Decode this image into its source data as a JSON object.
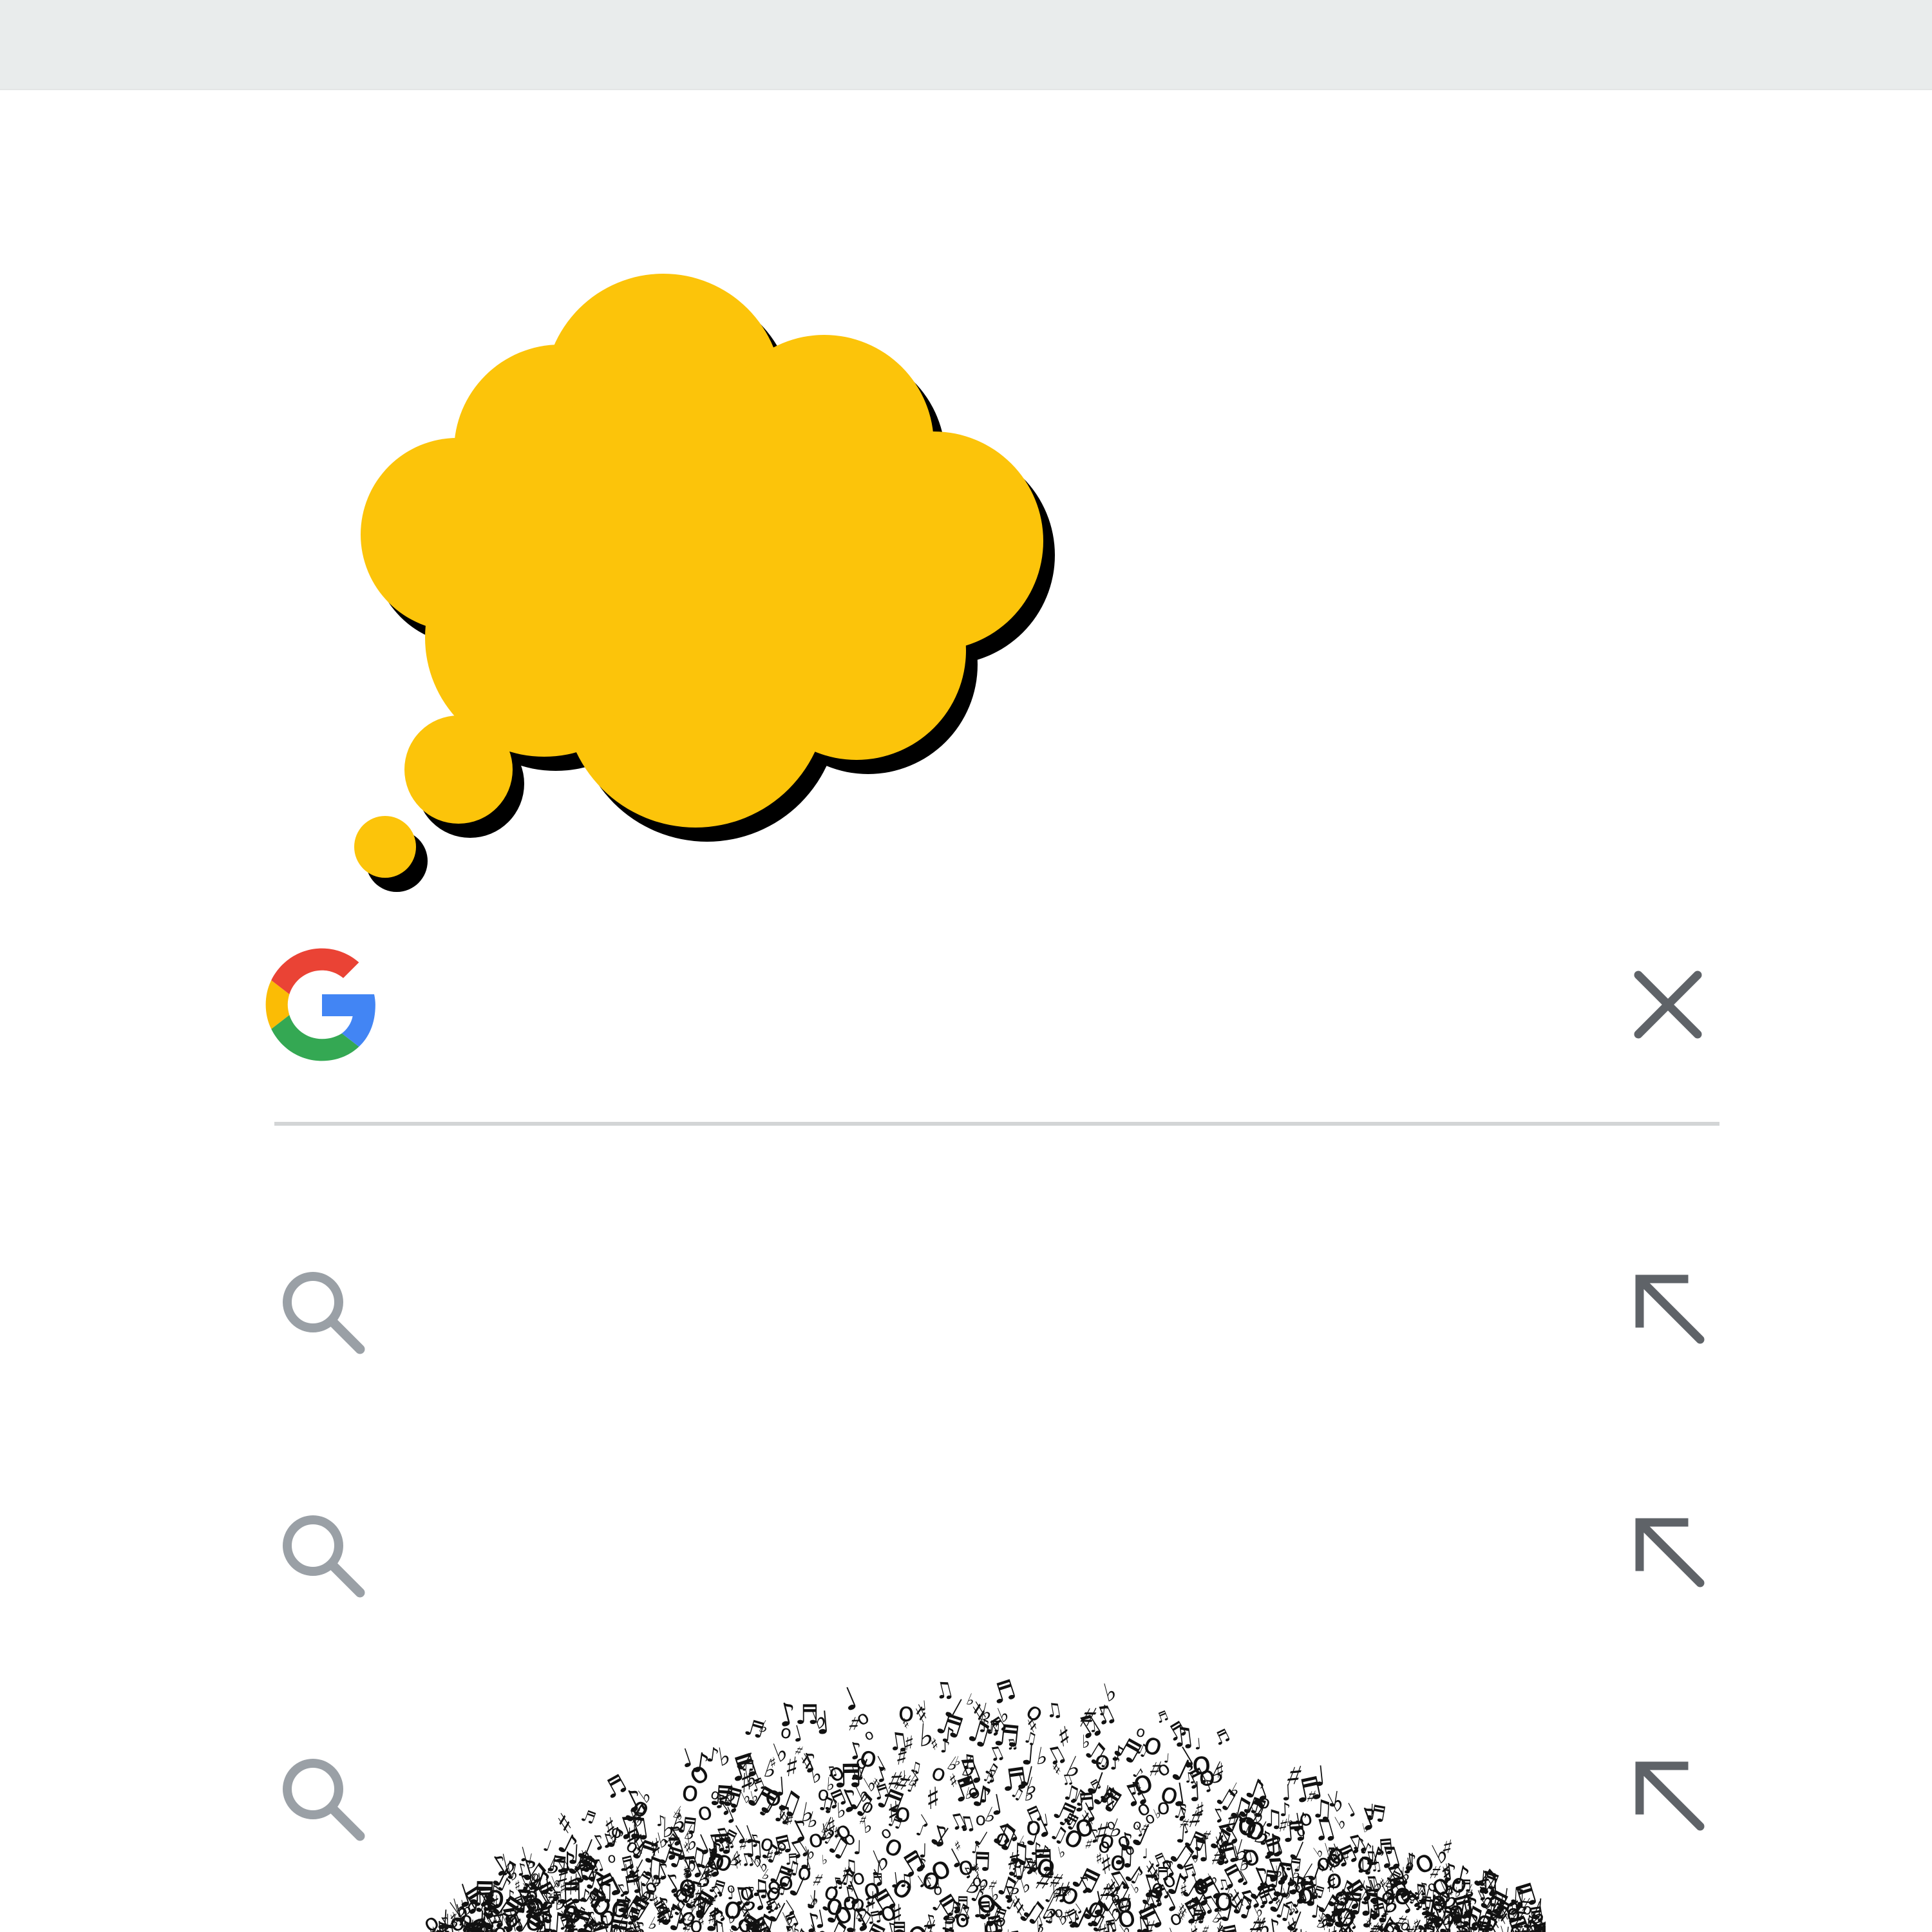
{
  "top_bar": {
    "color": "#e9ecec"
  },
  "illustration": {
    "thought_bubble_color": "#fcc40a",
    "shadow_color": "#000000",
    "music_notes_color": "#111111"
  },
  "search": {
    "query": "",
    "placeholder": "",
    "logo_icon": "google-g-icon",
    "clear_icon": "close-icon",
    "logo_colors": {
      "blue": "#4285f4",
      "red": "#ea4335",
      "yellow": "#fbbc05",
      "green": "#34a853"
    }
  },
  "suggestions": [
    {
      "text": "",
      "icon": "search-icon",
      "action_icon": "fill-query-arrow-icon"
    },
    {
      "text": "",
      "icon": "search-icon",
      "action_icon": "fill-query-arrow-icon"
    },
    {
      "text": "",
      "icon": "search-icon",
      "action_icon": "fill-query-arrow-icon"
    }
  ],
  "colors": {
    "icon_gray": "#9aa0a6",
    "close_gray": "#5f6368",
    "divider": "#d3d5d6",
    "background": "#ffffff"
  }
}
